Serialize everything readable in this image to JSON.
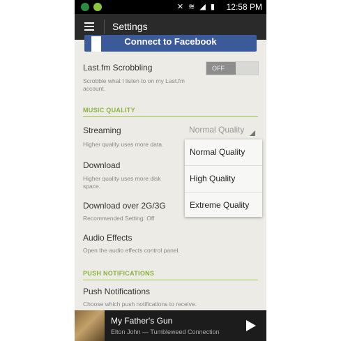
{
  "status": {
    "time": "12:58 PM",
    "icons": "✕ ≋ ◢ ▮"
  },
  "appbar": {
    "title": "Settings"
  },
  "facebook": {
    "label": "Connect to Facebook"
  },
  "scrobbling": {
    "title": "Last.fm Scrobbling",
    "sub": "Scrobble what I listen to on my Last.fm account.",
    "toggle": "OFF"
  },
  "sections": {
    "music_quality": "MUSIC QUALITY",
    "push": "PUSH NOTIFICATIONS"
  },
  "streaming": {
    "title": "Streaming",
    "sub": "Higher quality uses more data.",
    "value": "Normal Quality"
  },
  "download": {
    "title": "Download",
    "sub": "Higher quality uses more disk space."
  },
  "download2g": {
    "title": "Download over 2G/3G",
    "sub": "Recommended Setting: Off"
  },
  "audio": {
    "title": "Audio Effects",
    "sub": "Open the audio effects control panel."
  },
  "push": {
    "title": "Push Notifications",
    "sub": "Choose which push notifications to receive."
  },
  "dropdown": {
    "options": [
      "Normal Quality",
      "High Quality",
      "Extreme Quality"
    ]
  },
  "player": {
    "track": "My Father's Gun",
    "artist": "Elton John — Tumbleweed Connection"
  },
  "colors": {
    "accent": "#8ab33c",
    "facebook": "#3b5a9a",
    "appbar": "#2a2a2a"
  }
}
